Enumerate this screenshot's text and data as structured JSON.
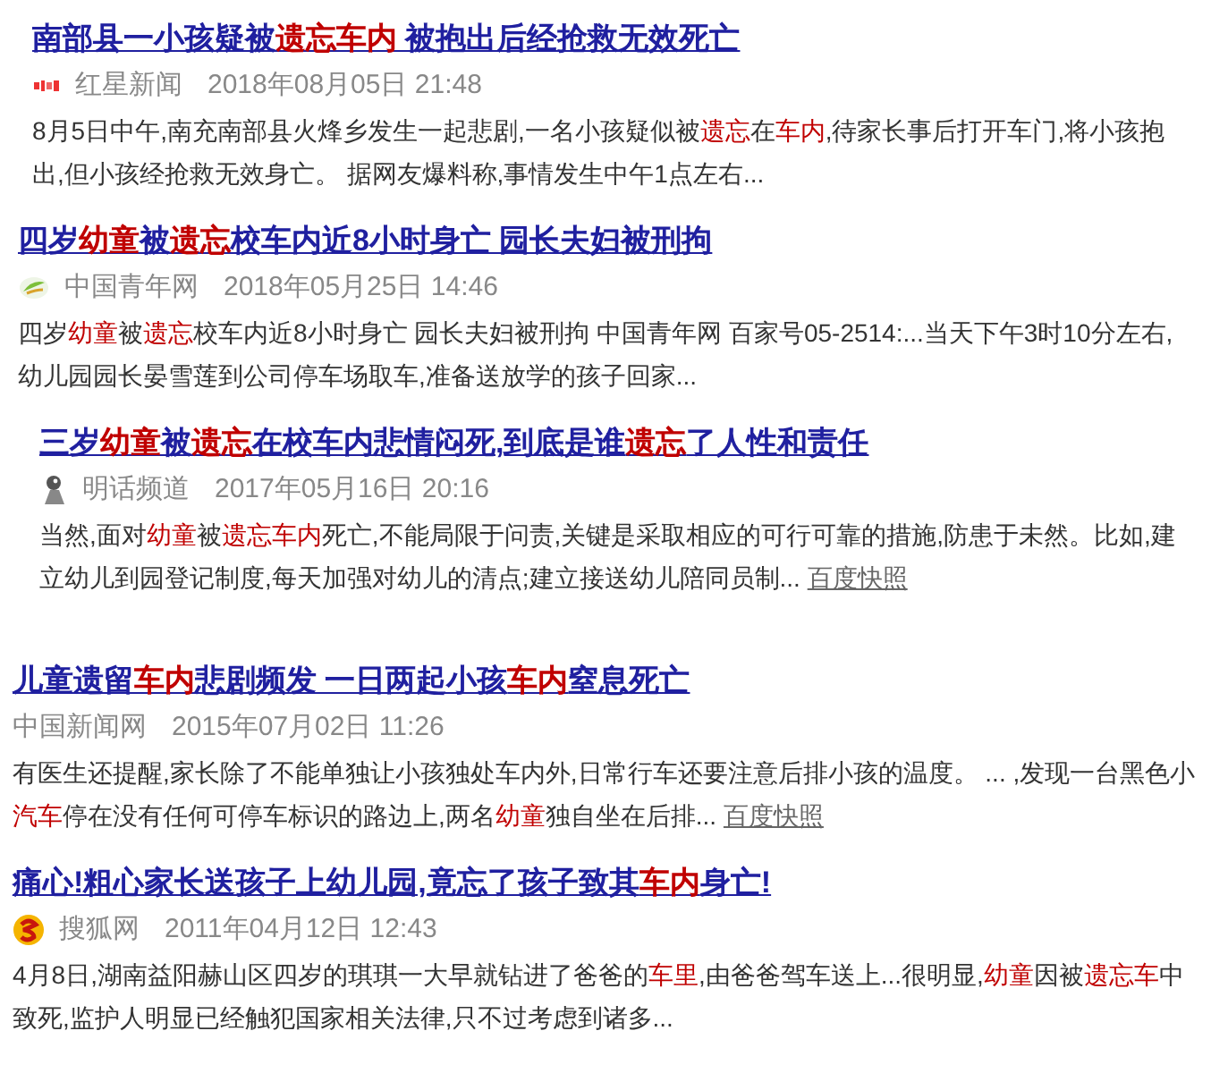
{
  "results": [
    {
      "title": [
        {
          "text": "南部县一小孩疑被",
          "kind": "plain"
        },
        {
          "text": "遗忘车内",
          "kind": "hit"
        },
        {
          "text": " 被抱出后经抢救无效死亡",
          "kind": "plain"
        }
      ],
      "source": {
        "name": "红星新闻",
        "logo": {
          "kind": "redtext"
        }
      },
      "time": "2018年08月05日 21:48",
      "snippet": [
        {
          "text": "8月5日中午,南充南部县火烽乡发生一起悲剧,一名小孩疑似被",
          "kind": "plain"
        },
        {
          "text": "遗忘",
          "kind": "hit"
        },
        {
          "text": "在",
          "kind": "plain"
        },
        {
          "text": "车内",
          "kind": "hit"
        },
        {
          "text": ",待家长事后打开车门,将小孩抱出,但小孩经抢救无效身亡。 据网友爆料称,事情发生中午1点左右...",
          "kind": "plain"
        }
      ]
    },
    {
      "title": [
        {
          "text": "四岁",
          "kind": "plain"
        },
        {
          "text": "幼童",
          "kind": "hit"
        },
        {
          "text": "被",
          "kind": "plain"
        },
        {
          "text": "遗忘",
          "kind": "hit"
        },
        {
          "text": "校车内近8小时身亡 园长夫妇被刑拘",
          "kind": "plain"
        }
      ],
      "source": {
        "name": "中国青年网",
        "logo": {
          "kind": "leaf"
        }
      },
      "time": "2018年05月25日 14:46",
      "snippet": [
        {
          "text": "四岁",
          "kind": "plain"
        },
        {
          "text": "幼童",
          "kind": "hit"
        },
        {
          "text": "被",
          "kind": "plain"
        },
        {
          "text": "遗忘",
          "kind": "hit"
        },
        {
          "text": "校车内近8小时身亡 园长夫妇被刑拘 中国青年网 百家号05-2514:...当天下午3时10分左右,幼儿园园长晏雪莲到公司停车场取车,准备送放学的孩子回家...",
          "kind": "plain"
        }
      ]
    },
    {
      "title": [
        {
          "text": "三岁",
          "kind": "plain"
        },
        {
          "text": "幼童",
          "kind": "hit"
        },
        {
          "text": "被",
          "kind": "plain"
        },
        {
          "text": "遗忘",
          "kind": "hit"
        },
        {
          "text": "在校车内悲情闷死,到底是谁",
          "kind": "plain"
        },
        {
          "text": "遗忘",
          "kind": "hit"
        },
        {
          "text": "了人性和责任",
          "kind": "plain"
        }
      ],
      "source": {
        "name": "明话频道",
        "logo": {
          "kind": "figure"
        }
      },
      "time": "2017年05月16日 20:16",
      "snippet": [
        {
          "text": "当然,面对",
          "kind": "plain"
        },
        {
          "text": "幼童",
          "kind": "hit"
        },
        {
          "text": "被",
          "kind": "plain"
        },
        {
          "text": "遗忘车内",
          "kind": "hit"
        },
        {
          "text": "死亡,不能局限于问责,关键是采取相应的可行可靠的措施,防患于未然。比如,建立幼儿到园登记制度,每天加强对幼儿的清点;建立接送幼儿陪同员制... ",
          "kind": "plain"
        },
        {
          "text": "百度快照",
          "kind": "link"
        }
      ]
    },
    {
      "title": [
        {
          "text": "儿童遗留",
          "kind": "plain"
        },
        {
          "text": "车内",
          "kind": "hit"
        },
        {
          "text": "悲剧频发 一日两起小孩",
          "kind": "plain"
        },
        {
          "text": "车内",
          "kind": "hit"
        },
        {
          "text": "窒息死亡",
          "kind": "plain"
        }
      ],
      "source": {
        "name": "中国新闻网"
      },
      "time": "2015年07月02日 11:26",
      "snippet": [
        {
          "text": "有医生还提醒,家长除了不能单独让小孩独处车内外,日常行车还要注意后排小孩的温度。 ... ,发现一台黑色小",
          "kind": "plain"
        },
        {
          "text": "汽车",
          "kind": "hit"
        },
        {
          "text": "停在没有任何可停车标识的路边上,两名",
          "kind": "plain"
        },
        {
          "text": "幼童",
          "kind": "hit"
        },
        {
          "text": "独自坐在后排... ",
          "kind": "plain"
        },
        {
          "text": "百度快照",
          "kind": "link"
        }
      ]
    },
    {
      "title": [
        {
          "text": "痛心!粗心家长送孩子上幼儿园,竟忘了孩子致其",
          "kind": "plain"
        },
        {
          "text": "车内",
          "kind": "hit"
        },
        {
          "text": "身亡!",
          "kind": "plain"
        }
      ],
      "source": {
        "name": "搜狐网",
        "logo": {
          "kind": "fox"
        }
      },
      "time": "2011年04月12日 12:43",
      "snippet": [
        {
          "text": "4月8日,湖南益阳赫山区四岁的琪琪一大早就钻进了爸爸的",
          "kind": "plain"
        },
        {
          "text": "车里",
          "kind": "hit"
        },
        {
          "text": ",由爸爸驾车送上...很明显,",
          "kind": "plain"
        },
        {
          "text": "幼童",
          "kind": "hit"
        },
        {
          "text": "因被",
          "kind": "plain"
        },
        {
          "text": "遗忘车",
          "kind": "hit"
        },
        {
          "text": "中致死,监护人明显已经触犯国家相关法律,只不过考虑到诸多...",
          "kind": "plain"
        }
      ]
    }
  ]
}
